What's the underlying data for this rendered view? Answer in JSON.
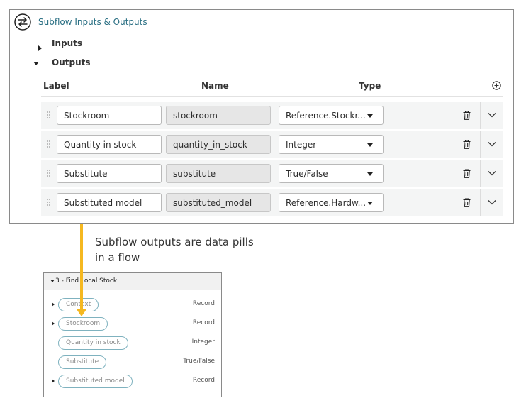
{
  "panel": {
    "title": "Subflow Inputs & Outputs",
    "inputs_label": "Inputs",
    "outputs_label": "Outputs",
    "columns": {
      "label": "Label",
      "name": "Name",
      "type": "Type"
    },
    "rows": [
      {
        "label": "Stockroom",
        "name": "stockroom",
        "type": "Reference.Stockr..."
      },
      {
        "label": "Quantity in stock",
        "name": "quantity_in_stock",
        "type": "Integer"
      },
      {
        "label": "Substitute",
        "name": "substitute",
        "type": "True/False"
      },
      {
        "label": "Substituted model",
        "name": "substituted_model",
        "type": "Reference.Hardw..."
      }
    ]
  },
  "caption": "Subflow outputs are data pills in a flow",
  "pills": {
    "header": "3 - Find Local Stock",
    "items": [
      {
        "label": "Context",
        "type": "Record",
        "expandable": true
      },
      {
        "label": "Stockroom",
        "type": "Record",
        "expandable": true
      },
      {
        "label": "Quantity in stock",
        "type": "Integer",
        "expandable": false
      },
      {
        "label": "Substitute",
        "type": "True/False",
        "expandable": false
      },
      {
        "label": "Substituted model",
        "type": "Record",
        "expandable": true
      }
    ]
  },
  "colors": {
    "accent_link": "#2a6f83",
    "connector": "#f5b820",
    "pill_border": "#7fb2bf"
  },
  "icons": [
    "swap-arrows-icon",
    "add-circle-icon",
    "drag-handle-icon",
    "trash-icon",
    "chevron-down-icon"
  ]
}
